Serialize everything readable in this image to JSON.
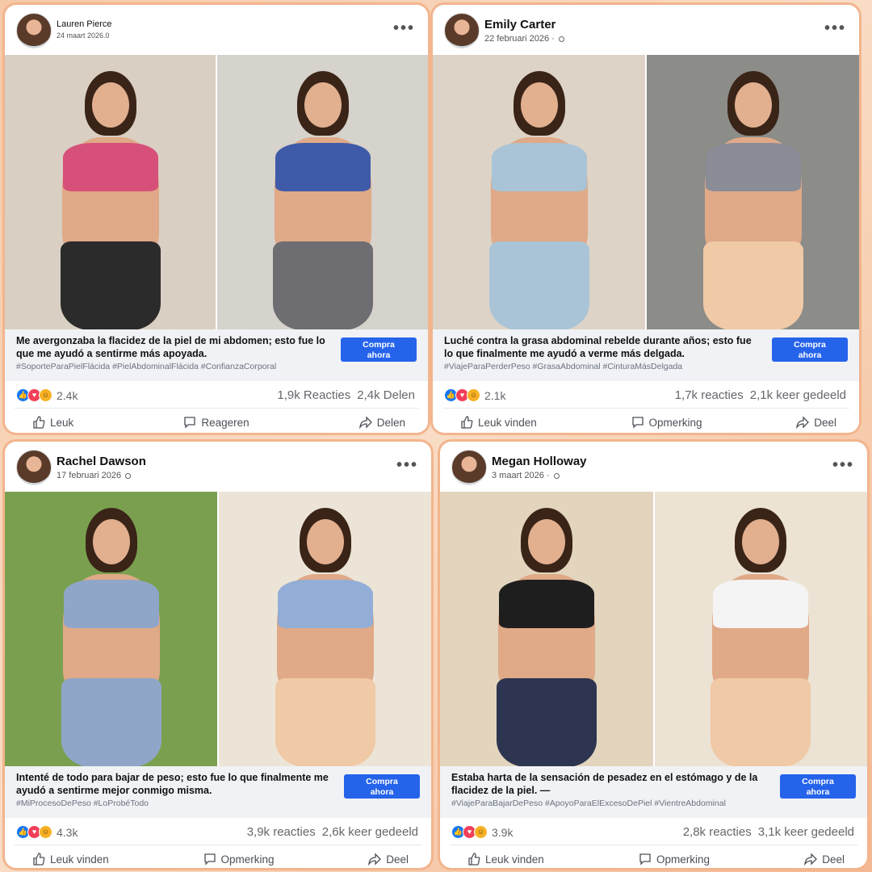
{
  "posts": [
    {
      "author": "Lauren Pierce",
      "date": "24 maart 2026.0",
      "caption": "Me avergonzaba la flacidez de la piel de mi abdomen; esto fue lo que me ayudó a sentirme más apoyada.",
      "hashtags": "#SoporteParaPielFlácida #PielAbdominalFlácida #ConfianzaCorporal",
      "cta_line1": "Compra",
      "cta_line2": "ahora",
      "reaction_count": "2.4k",
      "reactions_text": "1,9k Reacties",
      "shares_text": "2,4k Delen",
      "like_label": "Leuk",
      "comment_label": "Reageren",
      "share_label": "Delen",
      "photo_colors": {
        "left_bg": "#d9cfc3",
        "right_bg": "#d6d2cc",
        "left_top": "#d6507a",
        "left_bottom": "#2b2b2b",
        "right_top": "#3f5aa8",
        "right_bottom": "#6e6e72"
      }
    },
    {
      "author": "Emily Carter",
      "date": "22 februari 2026 ·",
      "caption": "Luché contra la grasa abdominal rebelde durante años; esto fue lo que finalmente me ayudó a verme más delgada.",
      "hashtags": "#ViajeParaPerderPeso #GrasaAbdominal #CinturaMásDelgada",
      "cta_line1": "Compra",
      "cta_line2": "ahora",
      "reaction_count": "2.1k",
      "reactions_text": "1,7k reacties",
      "shares_text": "2,1k keer gedeeld",
      "like_label": "Leuk vinden",
      "comment_label": "Opmerking",
      "share_label": "Deel",
      "photo_colors": {
        "left_bg": "#ddd3c6",
        "right_bg": "#8c8c88",
        "left_top": "#a9c4d6",
        "left_bottom": "#a9c4d6",
        "right_top": "#8a8c96",
        "right_bottom": "#f0c9a6"
      }
    },
    {
      "author": "Rachel Dawson",
      "date": "17 februari 2026",
      "caption": "Intenté de todo para bajar de peso; esto fue lo que finalmente me ayudó a sentirme mejor conmigo misma.",
      "hashtags": "#MiProcesoDePeso #LoProbéTodo",
      "cta_line1": "Compra",
      "cta_line2": "ahora",
      "reaction_count": "4.3k",
      "reactions_text": "3,9k reacties",
      "shares_text": "2,6k keer gedeeld",
      "like_label": "Leuk vinden",
      "comment_label": "Opmerking",
      "share_label": "Deel",
      "photo_colors": {
        "left_bg": "#7aa04f",
        "right_bg": "#ece4d6",
        "left_top": "#8fa6c8",
        "left_bottom": "#8fa6c8",
        "right_top": "#93aed6",
        "right_bottom": "#f0c9a6"
      }
    },
    {
      "author": "Megan Holloway",
      "date": "3 maart 2026 ·",
      "caption": "Estaba harta de la sensación de pesadez en el estómago y de la flacidez de la piel. —",
      "hashtags": "#ViajeParaBajarDePeso #ApoyoParaElExcesoDePiel #VientreAbdominal",
      "cta_line1": "Compra",
      "cta_line2": "ahora",
      "reaction_count": "3.9k",
      "reactions_text": "2,8k reacties",
      "shares_text": "3,1k keer gedeeld",
      "like_label": "Leuk vinden",
      "comment_label": "Opmerking",
      "share_label": "Deel",
      "photo_colors": {
        "left_bg": "#e2d4bd",
        "right_bg": "#ece3d4",
        "left_top": "#1e1e1e",
        "left_bottom": "#2d3550",
        "right_top": "#f4f4f4",
        "right_bottom": "#f0c9a6"
      }
    }
  ]
}
